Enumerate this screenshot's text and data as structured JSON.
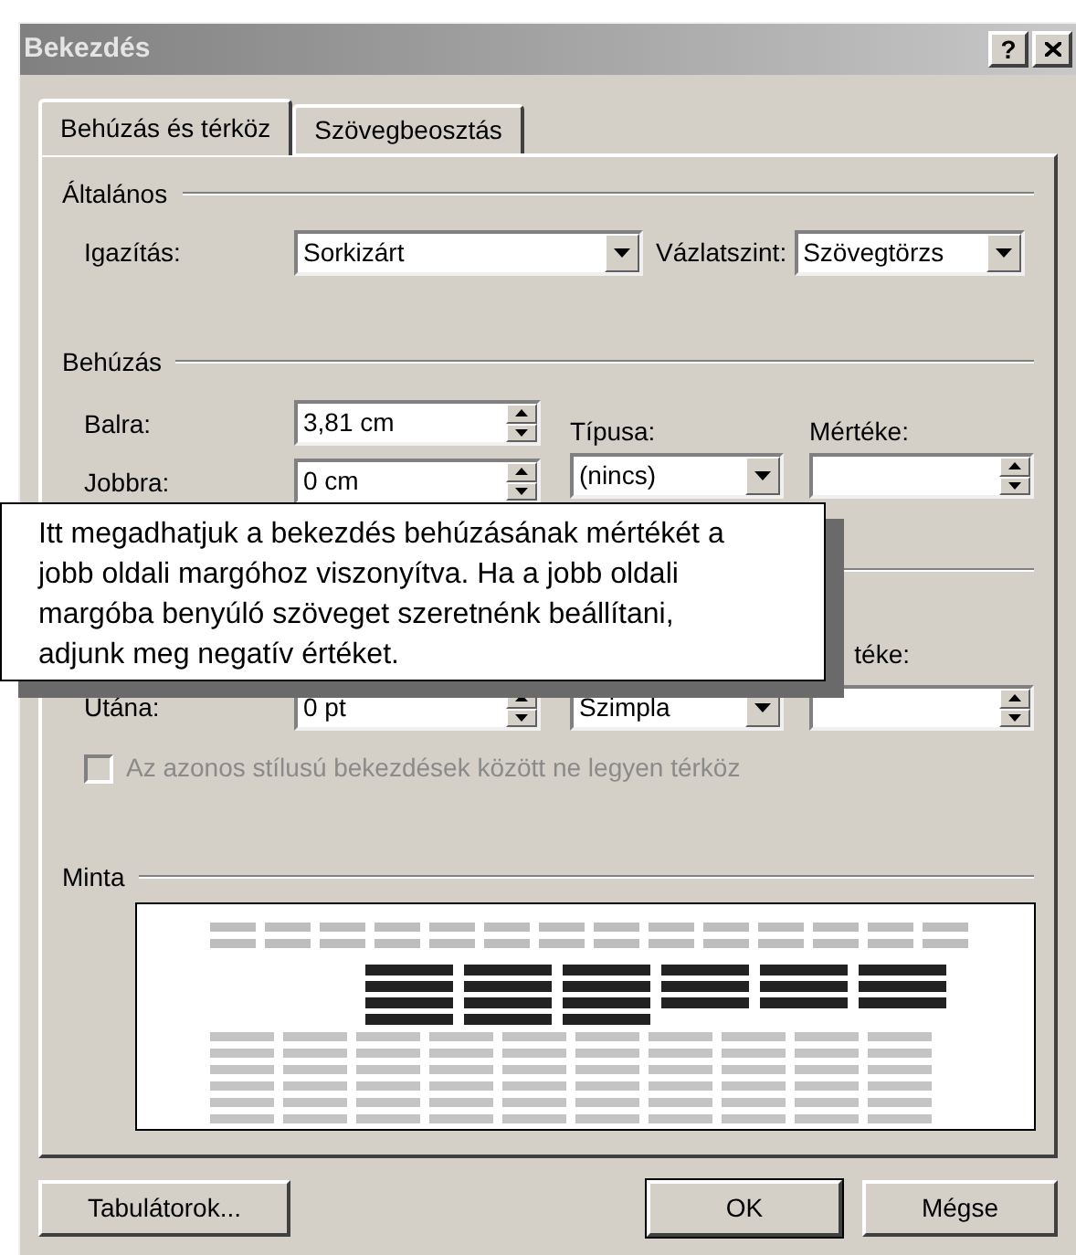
{
  "window": {
    "title": "Bekezdés",
    "help_button": "?"
  },
  "tabs": [
    {
      "label": "Behúzás és térköz",
      "selected": true
    },
    {
      "label": "Szövegbeosztás",
      "selected": false
    }
  ],
  "general": {
    "heading": "Általános",
    "alignment": {
      "label": "Igazítás:",
      "value": "Sorkizárt"
    },
    "outline_level": {
      "label": "Vázlatszint:",
      "value": "Szövegtörzs"
    }
  },
  "indentation": {
    "heading": "Behúzás",
    "left": {
      "label": "Balra:",
      "value": "3,81 cm"
    },
    "right": {
      "label": "Jobbra:",
      "value": "0 cm"
    },
    "special": {
      "label": "Típusa:",
      "value": "(nincs)"
    },
    "by": {
      "label": "Mértéke:"
    }
  },
  "spacing": {
    "after": {
      "label": "Utána:",
      "value": "0 pt"
    },
    "line_spacing": {
      "value": "Szimpla"
    },
    "at": {
      "label": "téke:"
    }
  },
  "checkbox": {
    "label": "Az azonos stílusú bekezdések között ne legyen térköz",
    "checked": false,
    "disabled": true
  },
  "preview": {
    "heading": "Minta"
  },
  "buttons_left": [
    {
      "label": "Tabulátorok...",
      "default": false
    }
  ],
  "buttons_right": [
    {
      "label": "OK",
      "default": true
    },
    {
      "label": "Mégse",
      "default": false
    }
  ],
  "tooltip": {
    "lines": [
      "Itt megadhatjuk a bekezdés behúzásának mértékét a",
      "jobb oldali margóhoz viszonyítva. Ha a jobb oldali",
      "margóba benyúló szöveget szeretnénk beállítani,",
      "adjunk meg negatív értéket."
    ]
  }
}
